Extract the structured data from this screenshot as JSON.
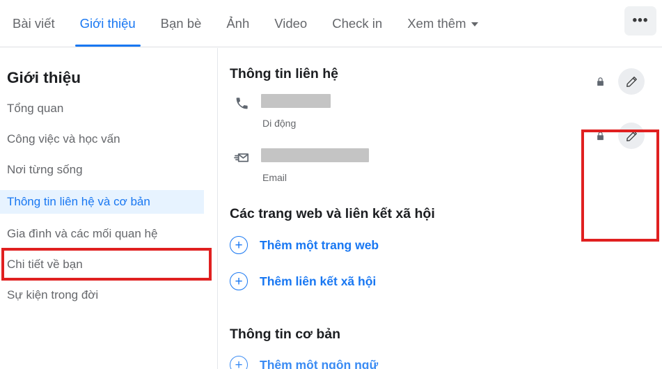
{
  "tabs": [
    {
      "label": "Bài viết",
      "active": false,
      "has_caret": false
    },
    {
      "label": "Giới thiệu",
      "active": true,
      "has_caret": false
    },
    {
      "label": "Bạn bè",
      "active": false,
      "has_caret": false
    },
    {
      "label": "Ảnh",
      "active": false,
      "has_caret": false
    },
    {
      "label": "Video",
      "active": false,
      "has_caret": false
    },
    {
      "label": "Check in",
      "active": false,
      "has_caret": false
    },
    {
      "label": "Xem thêm",
      "active": false,
      "has_caret": true
    }
  ],
  "more_button": {
    "icon": "ellipsis-horizontal-icon",
    "label": "•••"
  },
  "sidebar": {
    "title": "Giới thiệu",
    "items": [
      {
        "label": "Tổng quan",
        "selected": false
      },
      {
        "label": "Công việc và học vấn",
        "selected": false
      },
      {
        "label": "Nơi từng sống",
        "selected": false
      },
      {
        "label": "Thông tin liên hệ và cơ bản",
        "selected": true
      },
      {
        "label": "Gia đình và các mối quan hệ",
        "selected": false
      },
      {
        "label": "Chi tiết về bạn",
        "selected": false
      },
      {
        "label": "Sự kiện trong đời",
        "selected": false
      }
    ]
  },
  "content": {
    "contact_heading": "Thông tin liên hệ",
    "contact_rows": [
      {
        "icon": "phone-icon",
        "value_redacted": true,
        "sublabel": "Di động",
        "privacy_icon": "lock-icon",
        "edit_icon": "pencil-icon",
        "redact_width": 100
      },
      {
        "icon": "envelope-icon",
        "value_redacted": true,
        "sublabel": "Email",
        "privacy_icon": "lock-icon",
        "edit_icon": "pencil-icon",
        "redact_width": 155
      }
    ],
    "websites_heading": "Các trang web và liên kết xã hội",
    "add_website_label": "Thêm một trang web",
    "add_social_label": "Thêm liên kết xã hội",
    "basic_heading": "Thông tin cơ bản",
    "add_language_label": "Thêm một ngôn ngữ"
  },
  "annotations": {
    "sidebar_highlight_color": "#e02020",
    "actions_highlight_color": "#e02020"
  },
  "colors": {
    "accent_blue": "#1877f2",
    "selected_bg": "#e7f3ff",
    "text_gray": "#65676b",
    "text_dark": "#1c1e21",
    "redact_gray": "#c4c4c4",
    "annotation_red": "#e02020"
  }
}
